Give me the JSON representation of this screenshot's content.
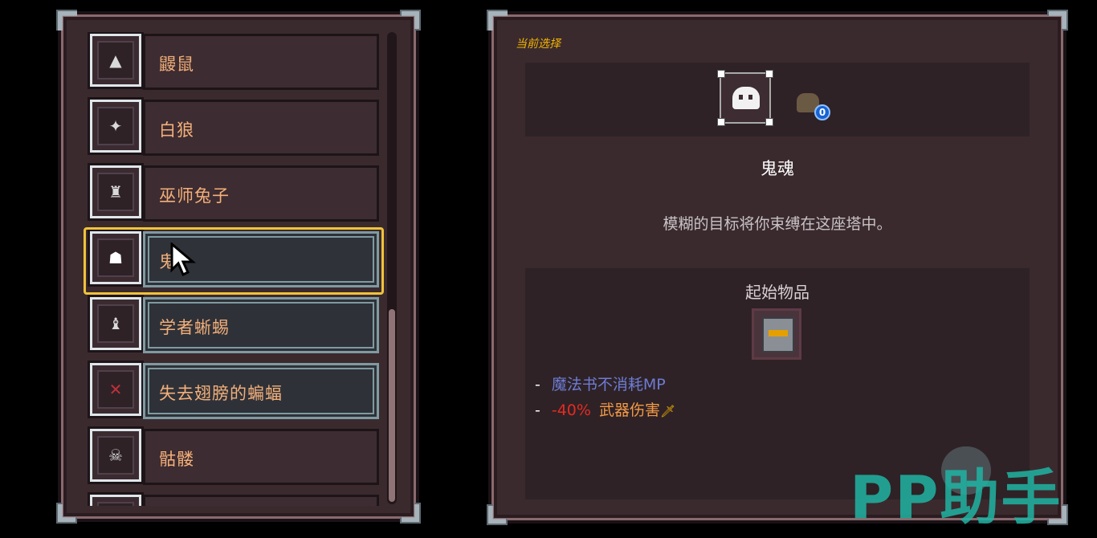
{
  "character_list": {
    "items": [
      {
        "label": "鼹鼠",
        "icon": "mole-icon"
      },
      {
        "label": "白狼",
        "icon": "white-wolf-icon"
      },
      {
        "label": "巫师兔子",
        "icon": "wizard-rabbit-icon"
      },
      {
        "label": "鬼魂",
        "icon": "ghost-icon",
        "selected": true
      },
      {
        "label": "学者蜥蜴",
        "icon": "scholar-lizard-icon"
      },
      {
        "label": "失去翅膀的蝙蝠",
        "icon": "wingless-bat-icon"
      },
      {
        "label": "骷髅",
        "icon": "skeleton-icon"
      }
    ],
    "visible_label_of_selected": "鬼"
  },
  "detail": {
    "current_selection_label": "当前选择",
    "pet_level_badge": "0",
    "character_name": "鬼魂",
    "description": "模糊的目标将你束缚在这座塔中。",
    "starting_items_title": "起始物品",
    "starting_item_icon": "magic-book-icon",
    "effects": [
      {
        "dash": "-",
        "text": "魔法书不消耗MP",
        "color": "#6e7bd4"
      },
      {
        "dash": "-",
        "value": "-40%",
        "text": "武器伤害",
        "value_color": "#e52b22",
        "text_color": "#f39a47",
        "suffix_icon": "sword-icon"
      }
    ]
  },
  "watermark": {
    "text": "PP助手",
    "color": "#1fb4a3"
  },
  "colors": {
    "selection_frame": "#f0c23a",
    "label_orange": "#f3b07a",
    "panel_bg": "#3a2a2e"
  }
}
